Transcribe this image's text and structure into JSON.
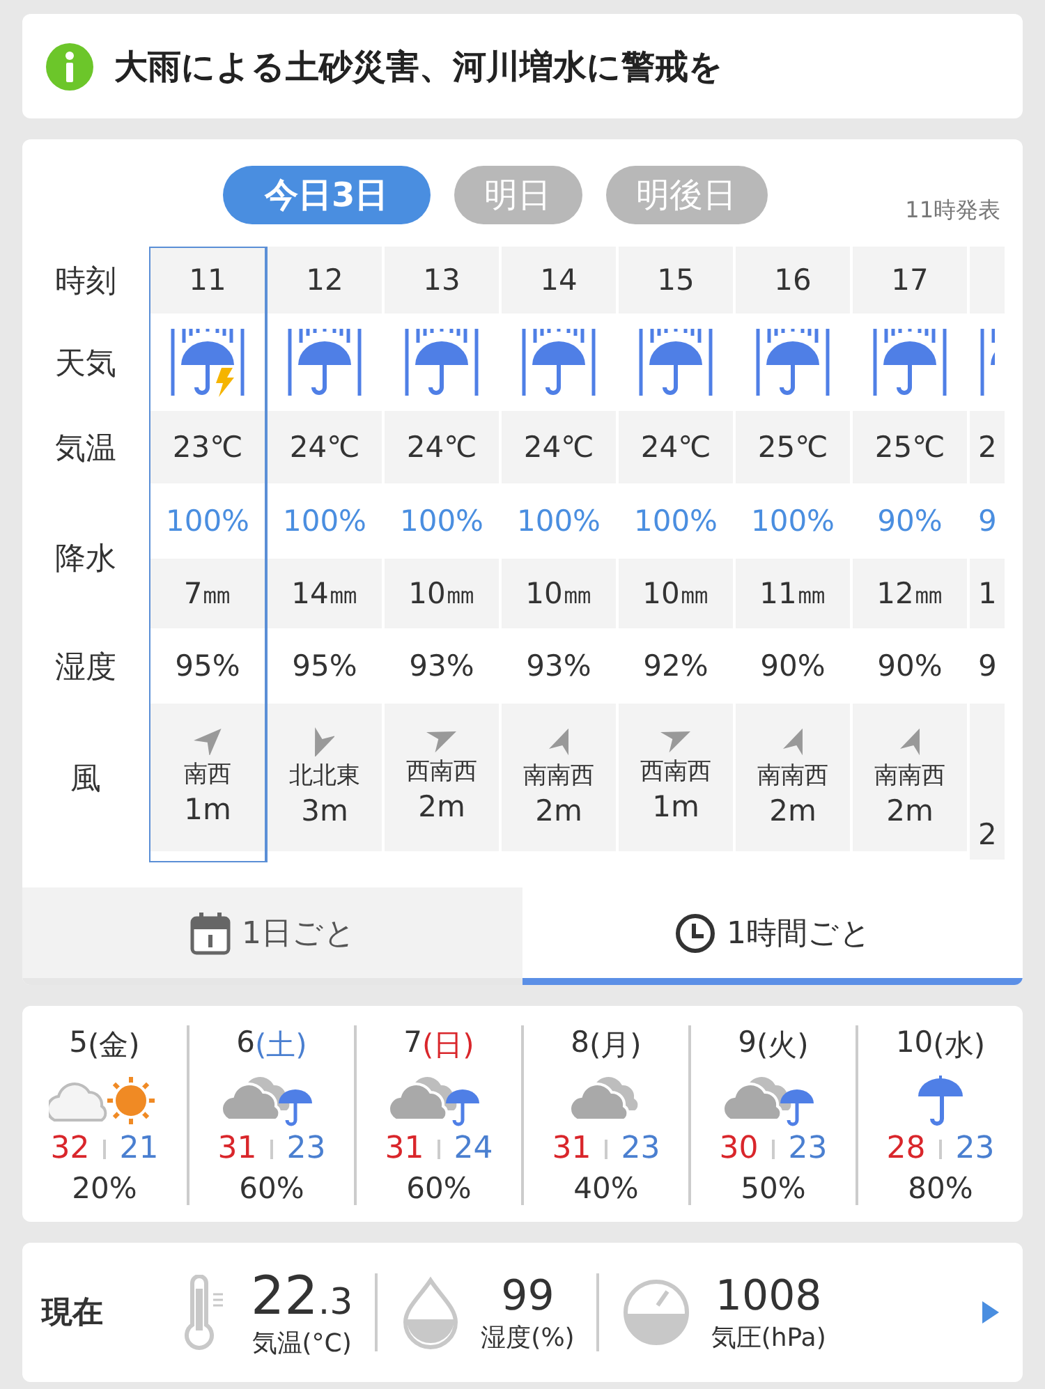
{
  "alert": {
    "text": "大雨による土砂災害、河川増水に警戒を"
  },
  "forecast": {
    "day_tabs": [
      {
        "label": "今日3日",
        "selected": true
      },
      {
        "label": "明日",
        "selected": false
      },
      {
        "label": "明後日",
        "selected": false
      }
    ],
    "issued": "11時発表",
    "row_labels": {
      "time": "時刻",
      "weather": "天気",
      "temp": "気温",
      "precip": "降水",
      "humidity": "湿度",
      "wind": "風"
    },
    "hours": [
      {
        "time": "11",
        "kind": "thunder_rain",
        "temp": "23℃",
        "prob": "100%",
        "amount": "7㎜",
        "humidity": "95%",
        "wind_arrow": {
          "kind": "NE"
        },
        "wind_dir": "南西",
        "wind_speed": "1m",
        "selected": true
      },
      {
        "time": "12",
        "kind": "rain",
        "temp": "24℃",
        "prob": "100%",
        "amount": "14㎜",
        "humidity": "95%",
        "wind_arrow": {
          "kind": "SSW"
        },
        "wind_dir": "北北東",
        "wind_speed": "3m",
        "selected": false
      },
      {
        "time": "13",
        "kind": "rain",
        "temp": "24℃",
        "prob": "100%",
        "amount": "10㎜",
        "humidity": "93%",
        "wind_arrow": {
          "kind": "ENE"
        },
        "wind_dir": "西南西",
        "wind_speed": "2m",
        "selected": false
      },
      {
        "time": "14",
        "kind": "rain",
        "temp": "24℃",
        "prob": "100%",
        "amount": "10㎜",
        "humidity": "93%",
        "wind_arrow": {
          "kind": "NNE"
        },
        "wind_dir": "南南西",
        "wind_speed": "2m",
        "selected": false
      },
      {
        "time": "15",
        "kind": "rain",
        "temp": "24℃",
        "prob": "100%",
        "amount": "10㎜",
        "humidity": "92%",
        "wind_arrow": {
          "kind": "ENE"
        },
        "wind_dir": "西南西",
        "wind_speed": "1m",
        "selected": false
      },
      {
        "time": "16",
        "kind": "rain",
        "temp": "25℃",
        "prob": "100%",
        "amount": "11㎜",
        "humidity": "90%",
        "wind_arrow": {
          "kind": "NNE"
        },
        "wind_dir": "南南西",
        "wind_speed": "2m",
        "selected": false
      },
      {
        "time": "17",
        "kind": "rain",
        "temp": "25℃",
        "prob": "90%",
        "amount": "12㎜",
        "humidity": "90%",
        "wind_arrow": {
          "kind": "NNE"
        },
        "wind_dir": "南南西",
        "wind_speed": "2m",
        "selected": false
      },
      {
        "kind": "rain",
        "temp": "2",
        "prob": "9",
        "amount": "1",
        "humidity": "9",
        "wind_speed": "2",
        "selected": false
      }
    ]
  },
  "view_tabs": [
    {
      "kind": "daily",
      "label": "1日ごと",
      "selected": false
    },
    {
      "kind": "hourly",
      "label": "1時間ごと",
      "selected": true
    }
  ],
  "week": [
    {
      "day": "5",
      "weekday": "(金)",
      "color": "#333333",
      "kind": "cloudy_sunny",
      "high": "32",
      "low": "21",
      "prob": "20%"
    },
    {
      "day": "6",
      "weekday": "(土)",
      "color": "#4a7fd0",
      "kind": "cloudy_rain",
      "high": "31",
      "low": "23",
      "prob": "60%"
    },
    {
      "day": "7",
      "weekday": "(日)",
      "color": "#d9262b",
      "kind": "cloudy_rain",
      "high": "31",
      "low": "24",
      "prob": "60%"
    },
    {
      "day": "8",
      "weekday": "(月)",
      "color": "#333333",
      "kind": "cloudy",
      "high": "31",
      "low": "23",
      "prob": "40%"
    },
    {
      "day": "9",
      "weekday": "(火)",
      "color": "#333333",
      "kind": "cloudy_rain",
      "high": "30",
      "low": "23",
      "prob": "50%"
    },
    {
      "day": "10",
      "weekday": "(水)",
      "color": "#333333",
      "kind": "rain",
      "high": "28",
      "low": "23",
      "prob": "80%"
    }
  ],
  "current": {
    "label": "現在",
    "items": [
      {
        "kind": "temperature",
        "value": "22",
        "decimal": ".3",
        "label": "気温(°C)"
      },
      {
        "kind": "humidity",
        "value": "99",
        "label": "湿度(%)"
      },
      {
        "kind": "pressure",
        "value": "1008",
        "label": "気圧(hPa)"
      }
    ]
  }
}
